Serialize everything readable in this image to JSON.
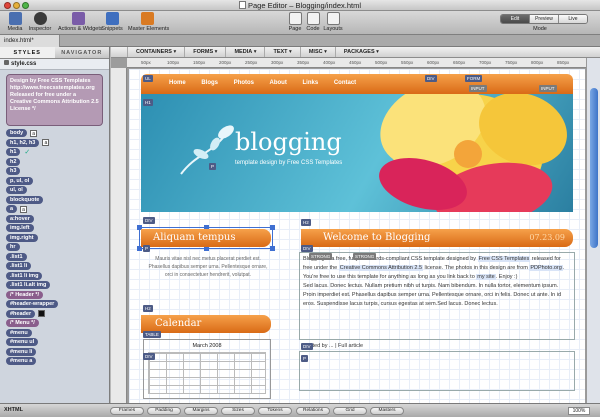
{
  "window": {
    "title": "Page Editor – Blogging/index.html"
  },
  "toolbar": {
    "items": [
      {
        "label": "Media",
        "icon": "media-icon",
        "color": "#4a6fb0"
      },
      {
        "label": "Inspector",
        "icon": "inspector-icon",
        "color": "#3a3a3a"
      },
      {
        "label": "Actions & Widgets",
        "icon": "actions-widgets-icon",
        "color": "#7a5ca8"
      },
      {
        "label": "Snippets",
        "icon": "snippets-icon",
        "color": "#3f6fbf"
      },
      {
        "label": "Master Elements",
        "icon": "master-elements-icon",
        "color": "#d97a22"
      }
    ],
    "view_items": [
      {
        "label": "Page",
        "icon": "page-icon"
      },
      {
        "label": "Code",
        "icon": "code-icon"
      },
      {
        "label": "Layouts",
        "icon": "layouts-icon"
      }
    ],
    "mode_options": [
      "Edit",
      "Preview",
      "Live Preview"
    ],
    "mode_label": "Mode"
  },
  "tabs": {
    "document": "index.html*"
  },
  "sidebar": {
    "tabs": [
      "STYLES",
      "NAVIGATOR"
    ],
    "css_file": "style.css",
    "comment": "Design by Free CSS Templates http://www.freecsstemplates.org Released for free under a Creative Commons Attribution 2.5 License */",
    "rules": [
      {
        "name": "body",
        "swatch": "a",
        "style": "normal"
      },
      {
        "name": "h1, h2, h3",
        "swatch": "a",
        "style": "normal"
      },
      {
        "name": "h1",
        "check": "✓",
        "style": "normal"
      },
      {
        "name": "h2",
        "style": "normal"
      },
      {
        "name": "h3",
        "style": "normal"
      },
      {
        "name": "p, ul, ol",
        "style": "normal"
      },
      {
        "name": "ul, ol",
        "style": "normal"
      },
      {
        "name": "blockquote",
        "style": "normal"
      },
      {
        "name": "a",
        "swatch": "a",
        "style": "normal"
      },
      {
        "name": "a:hover",
        "style": "normal"
      },
      {
        "name": "img.left",
        "style": "normal"
      },
      {
        "name": "img.right",
        "style": "normal"
      },
      {
        "name": "hr",
        "style": "normal"
      },
      {
        "name": ".list1",
        "style": "normal"
      },
      {
        "name": ".list1 li",
        "style": "normal"
      },
      {
        "name": ".list1 li img",
        "style": "normal"
      },
      {
        "name": ".list1 li.alt img",
        "style": "normal"
      },
      {
        "name": "/* Header */",
        "style": "purple"
      },
      {
        "name": "#header-wrapper",
        "style": "normal"
      },
      {
        "name": "#header",
        "swatch": " ",
        "style": "normal"
      },
      {
        "name": "/* Menu */",
        "style": "purple"
      },
      {
        "name": "#menu",
        "style": "normal"
      },
      {
        "name": "#menu ul",
        "style": "normal"
      },
      {
        "name": "#menu li",
        "style": "normal"
      },
      {
        "name": "#menu a",
        "style": "normal"
      }
    ]
  },
  "canvas": {
    "insert_menus": [
      "CONTAINERS",
      "FORMS",
      "MEDIA",
      "TEXT",
      "MISC",
      "PACKAGES"
    ],
    "ruler_ticks": [
      "50px",
      "100px",
      "150px",
      "200px",
      "250px",
      "300px",
      "350px",
      "400px",
      "450px",
      "500px",
      "550px",
      "600px",
      "650px",
      "700px",
      "750px",
      "800px",
      "850px"
    ],
    "menu_items": [
      "Home",
      "Blogs",
      "Photos",
      "About",
      "Links",
      "Contact"
    ],
    "logo": "blogging",
    "logo_sub": "template design by Free CSS Templates",
    "sidebar_heading": "Aliquam tempus",
    "sidebar_text": "Mauris vitae nisl nec metus placerat perdiet est. Phasellus dapibus semper urna. Pellentesque ornare, orci in consectetuer hendrerit, volutpat.",
    "calendar_heading": "Calendar",
    "calendar_month": "March 2008",
    "welcome_heading": "Welcome to Blogging",
    "post_date": "07.23.09",
    "post_text_1": "Blogging is a free, fully standards-compliant CSS template designed by ",
    "post_link_1": "Free CSS Templates",
    "post_text_2": " released for free under the ",
    "post_link_2": "Creative Commons Attribution 2.5",
    "post_text_3": " license. The photos in this design are from ",
    "post_link_3": "PDPhoto.org",
    "post_text_4": ". You're free to use this template for anything as long as you link back to ",
    "post_link_4": "my site",
    "post_text_5": ". Enjoy :)",
    "post_text_6": "Sed lacus. Donec lectus. Nullam pretium nibh ut turpis. Nam bibendum. In nulla tortor, elementum ipsum. Proin imperdiet est. Phasellus dapibus semper urna. Pellentesque ornare, orci in felis. Donec ut ante. In id eros. Suspendisse lacus turpis, cursus egestas at sem.Sed lacus. Donec lectus.",
    "post_meta": "Posted by ... | Full article",
    "badges": [
      "UL",
      "DIV",
      "FORM",
      "INPUT",
      "INPUT",
      "H1",
      "P",
      "DIV",
      "H2",
      "DIV",
      "P",
      "H2",
      "STRONG",
      "STRONG",
      "TABLE",
      "DIV",
      "P",
      "DIV"
    ]
  },
  "status": {
    "doctype": "XHTML",
    "buttons": [
      "Frames",
      "Padding",
      "Margins",
      "Sizes",
      "Tokens",
      "Relations",
      "Grid",
      "Masters"
    ],
    "zoom": "100%"
  },
  "colors": {
    "accent": "#d96a16",
    "selection": "#3f6fd1",
    "rule_pill": "#4e5a86"
  }
}
